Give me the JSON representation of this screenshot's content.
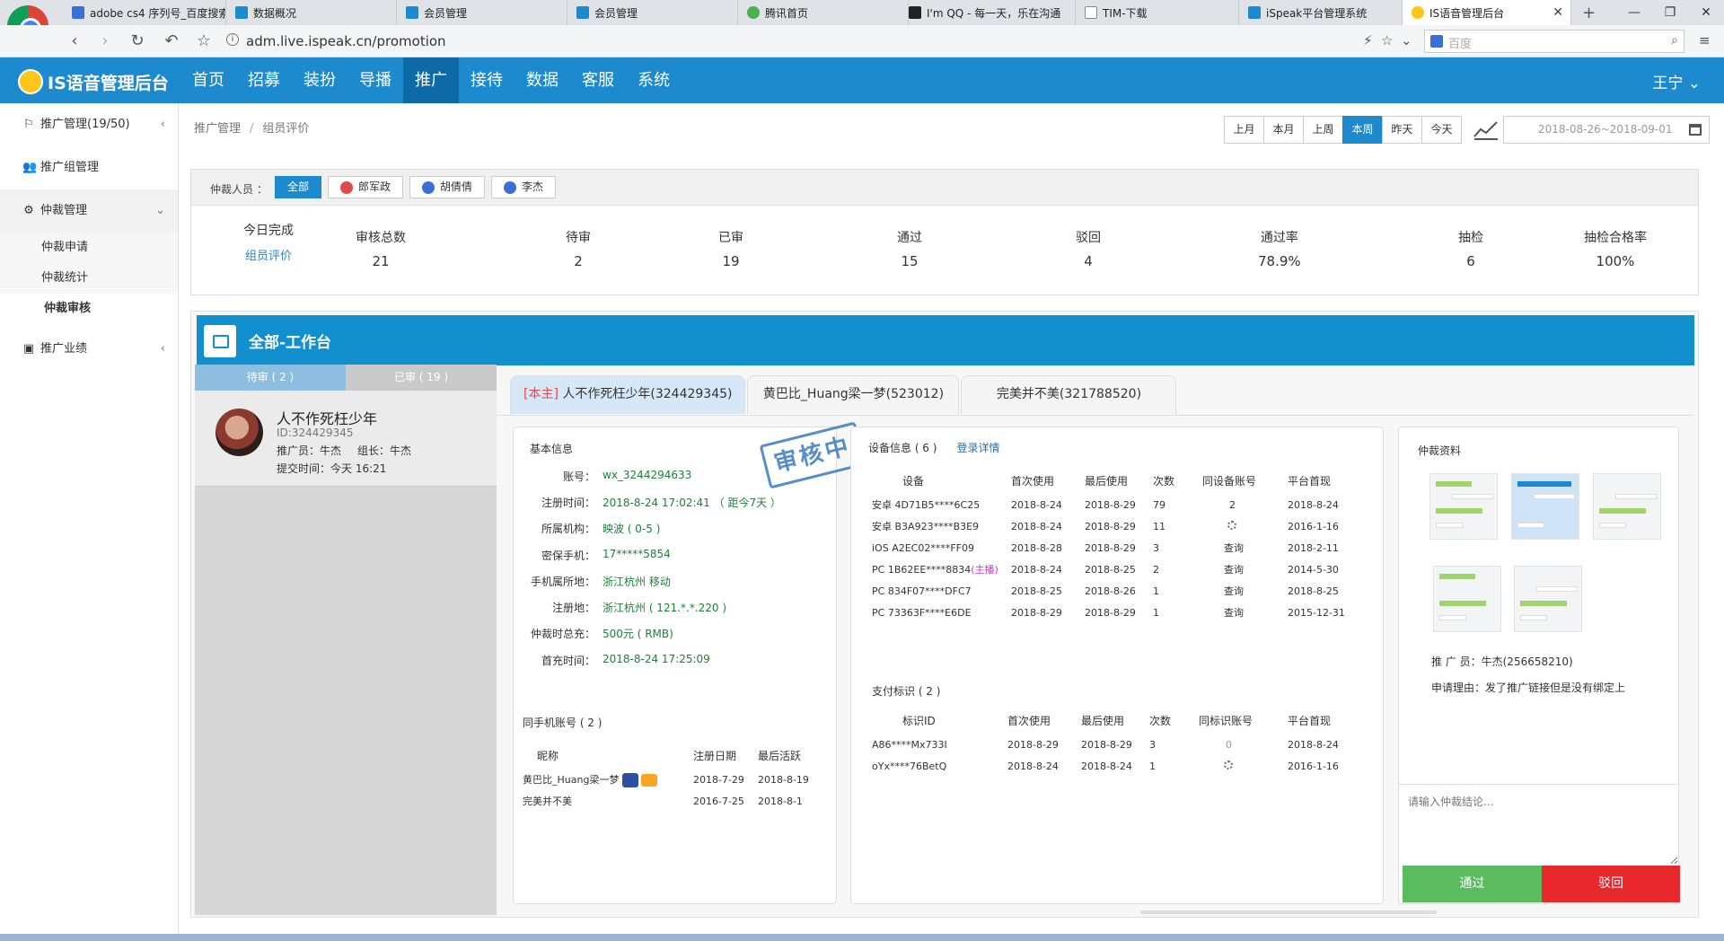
{
  "browser": {
    "tabs": [
      {
        "title": "adobe cs4 序列号_百度搜索",
        "color": "#3b6fd6"
      },
      {
        "title": "数据概况",
        "color": "#1d8ace"
      },
      {
        "title": "会员管理",
        "color": "#1d8ace"
      },
      {
        "title": "会员管理",
        "color": "#1d8ace"
      },
      {
        "title": "腾讯首页",
        "color": "#4caf50"
      },
      {
        "title": "I'm QQ - 每一天，乐在沟通",
        "color": "#222222"
      },
      {
        "title": "TIM-下载",
        "color": "#888888"
      },
      {
        "title": "iSpeak平台管理系统",
        "color": "#1d8ace"
      },
      {
        "title": "IS语音管理后台",
        "color": "#ffc61a"
      }
    ],
    "new_tab": "+",
    "url": "adm.live.ispeak.cn/promotion",
    "search_placeholder": "百度",
    "nav_icons": [
      "back-icon",
      "forward-icon",
      "reload-icon",
      "undo-icon",
      "star-icon"
    ],
    "window_controls": [
      "—",
      "❐",
      "✕"
    ]
  },
  "app": {
    "logo_text": "IS语音管理后台",
    "nav": [
      "首页",
      "招募",
      "装扮",
      "导播",
      "推广",
      "接待",
      "数据",
      "客服",
      "系统"
    ],
    "active_nav": "推广",
    "user": "王宁"
  },
  "sidebar": {
    "items": [
      {
        "label": "推广管理(19/50)",
        "icon": "flag-icon",
        "chevron": "‹"
      },
      {
        "label": "推广组管理",
        "icon": "users-icon"
      },
      {
        "label": "仲裁管理",
        "icon": "gear-icon",
        "chevron": "⌄"
      },
      {
        "label": "推广业绩",
        "icon": "chart-icon",
        "chevron": "‹"
      }
    ],
    "sub_items": [
      "仲裁申请",
      "仲裁统计",
      "仲裁审核"
    ],
    "active_sub": "仲裁审核"
  },
  "breadcrumb": [
    "推广管理",
    "组员评价"
  ],
  "range_buttons": [
    "上月",
    "本月",
    "上周",
    "本周",
    "昨天",
    "今天"
  ],
  "active_range": "本周",
  "date_range": "2018-08-26~2018-09-01",
  "filter": {
    "label": "仲裁人员 ：",
    "options": [
      "全部",
      "郎军政",
      "胡倩倩",
      "李杰"
    ],
    "active": "全部",
    "avatar_colors": [
      "#e04a4a",
      "#3b6fd6",
      "#3b6fd6"
    ]
  },
  "summary": {
    "today_label": "今日完成",
    "today_link": "组员评价",
    "stats": [
      {
        "label": "审核总数",
        "value": "21"
      },
      {
        "label": "待审",
        "value": "2"
      },
      {
        "label": "已审",
        "value": "19"
      },
      {
        "label": "通过",
        "value": "15"
      },
      {
        "label": "驳回",
        "value": "4"
      },
      {
        "label": "通过率",
        "value": "78.9%"
      },
      {
        "label": "抽检",
        "value": "6"
      },
      {
        "label": "抽检合格率",
        "value": "100%"
      }
    ]
  },
  "workbench": {
    "title": "全部-工作台",
    "queue_tabs": [
      "待审 ( 2 )",
      "已审 ( 19 )"
    ],
    "queue_card": {
      "name": "人不作死枉少年",
      "id": "ID:324429345",
      "promoter": "推广员：牛杰",
      "leader": "组长：牛杰",
      "submitted": "提交时间：今天 16:21"
    },
    "user_tabs": [
      {
        "tag": "[本主]",
        "label": "人不作死枉少年(324429345)"
      },
      {
        "tag": "",
        "label": "黄巴比_Huang梁一梦(523012)"
      },
      {
        "tag": "",
        "label": "完美并不美(321788520)"
      }
    ],
    "stamp": "审核中",
    "basic": {
      "title": "基本信息",
      "rows": [
        {
          "k": "账号：",
          "v": "wx_3244294633"
        },
        {
          "k": "注册时间：",
          "v": "2018-8-24 17:02:41 （ 距今7天 ）"
        },
        {
          "k": "所属机构：",
          "v": "映波 ( 0-5 )"
        },
        {
          "k": "密保手机：",
          "v": "17*****5854"
        },
        {
          "k": "手机属所地：",
          "v": "浙江杭州 移动"
        },
        {
          "k": "注册地：",
          "v": "浙江杭州 ( 121.*.*.220 )"
        },
        {
          "k": "仲裁时总充：",
          "v": "500元 ( RMB)"
        },
        {
          "k": "首充时间：",
          "v": "2018-8-24 17:25:09"
        }
      ]
    },
    "same_phone": {
      "title": "同手机账号 ( 2 )",
      "headers": [
        "昵称",
        "注册日期",
        "最后活跃"
      ],
      "rows": [
        {
          "nick": "黄巴比_Huang梁一梦",
          "reg": "2018-7-29",
          "last": "2018-8-19"
        },
        {
          "nick": "完美并不美",
          "reg": "2016-7-25",
          "last": "2018-8-1"
        }
      ]
    },
    "devices": {
      "title": "设备信息 ( 6 )",
      "login_link": "登录详情",
      "headers": [
        "设备",
        "首次使用",
        "最后使用",
        "次数",
        "同设备账号",
        "平台首现"
      ],
      "rows": [
        {
          "type": "安卓",
          "id": "4D71B5****6C25",
          "host": "",
          "first": "2018-8-24",
          "last": "2018-8-29",
          "count": "79",
          "same": "2",
          "platform": "2018-8-24"
        },
        {
          "type": "安卓",
          "id": "B3A923****B3E9",
          "host": "",
          "first": "2018-8-24",
          "last": "2018-8-29",
          "count": "11",
          "same": "",
          "platform": "2016-1-16"
        },
        {
          "type": "iOS",
          "id": "A2EC02****FF09",
          "host": "",
          "first": "2018-8-28",
          "last": "2018-8-29",
          "count": "3",
          "same": "查询",
          "platform": "2018-2-11"
        },
        {
          "type": "PC",
          "id": "1B62EE****8834",
          "host": "(主播)",
          "first": "2018-8-24",
          "last": "2018-8-25",
          "count": "2",
          "same": "查询",
          "platform": "2014-5-30"
        },
        {
          "type": "PC",
          "id": "834F07****DFC7",
          "host": "",
          "first": "2018-8-25",
          "last": "2018-8-26",
          "count": "1",
          "same": "查询",
          "platform": "2018-8-25"
        },
        {
          "type": "PC",
          "id": "73363F****E6DE",
          "host": "",
          "first": "2018-8-29",
          "last": "2018-8-29",
          "count": "1",
          "same": "查询",
          "platform": "2015-12-31"
        }
      ]
    },
    "payments": {
      "title": "支付标识 ( 2 )",
      "headers": [
        "标识ID",
        "首次使用",
        "最后使用",
        "次数",
        "同标识账号",
        "平台首现"
      ],
      "rows": [
        {
          "id": "A86****Mx733I",
          "first": "2018-8-29",
          "last": "2018-8-29",
          "count": "3",
          "same": "0",
          "platform": "2018-8-24"
        },
        {
          "id": "oYx****76BetQ",
          "first": "2018-8-24",
          "last": "2018-8-24",
          "count": "1",
          "same": "",
          "platform": "2016-1-16"
        }
      ]
    },
    "arbitration": {
      "title": "仲裁资料",
      "promoter": "推 广 员：牛杰(256658210)",
      "reason": "申请理由：发了推广链接但是没有绑定上",
      "placeholder": "请输入仲裁结论...",
      "pass": "通过",
      "reject": "驳回"
    }
  }
}
